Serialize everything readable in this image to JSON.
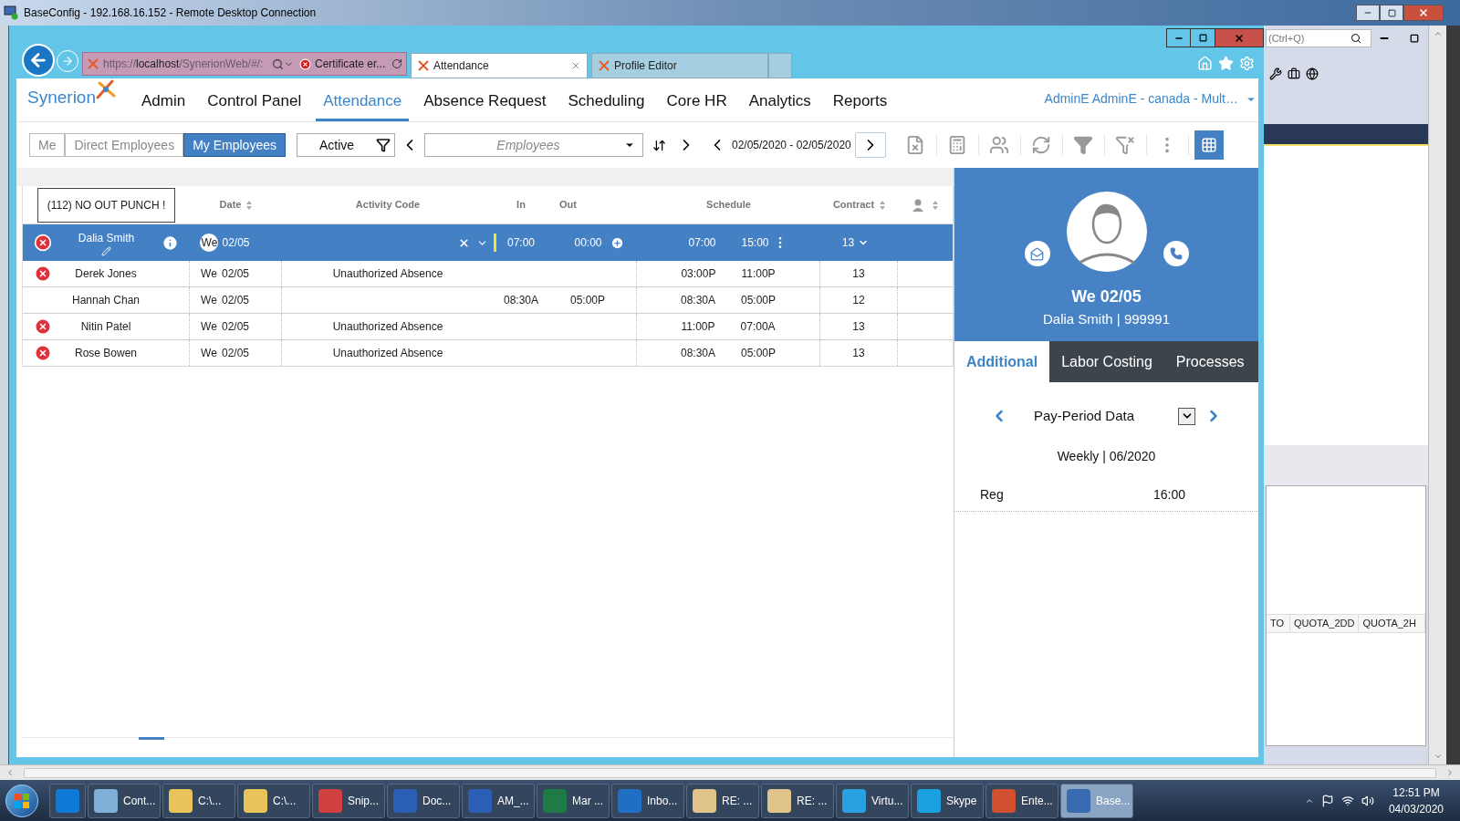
{
  "remote_window": {
    "title": "BaseConfig - 192.168.16.152 - Remote Desktop Connection"
  },
  "browser": {
    "address": {
      "scheme": "https://",
      "host": "localhost",
      "path": "/SynerionWeb/#/:"
    },
    "certificate": "Certificate er...",
    "tabs": [
      {
        "label": "Attendance",
        "selected": true
      },
      {
        "label": "Profile Editor",
        "selected": false
      }
    ]
  },
  "app": {
    "logo": "Synerion",
    "nav": [
      {
        "label": "Admin",
        "selected": false
      },
      {
        "label": "Control Panel",
        "selected": false
      },
      {
        "label": "Attendance",
        "selected": true
      },
      {
        "label": "Absence Request",
        "selected": false
      },
      {
        "label": "Scheduling",
        "selected": false
      },
      {
        "label": "Core HR",
        "selected": false
      },
      {
        "label": "Analytics",
        "selected": false
      },
      {
        "label": "Reports",
        "selected": false
      }
    ],
    "user": "AdminE AdminE - canada - Mult…",
    "scope": [
      {
        "label": "Me",
        "selected": false
      },
      {
        "label": "Direct Employees",
        "selected": false
      },
      {
        "label": "My Employees",
        "selected": true
      }
    ],
    "status_filter": "Active",
    "employee_select": {
      "placeholder": "Employees"
    },
    "date_range": "02/05/2020 - 02/05/2020"
  },
  "table": {
    "tooltip": "(112) NO OUT PUNCH !",
    "columns": [
      "Date",
      "Activity Code",
      "In",
      "Out",
      "Schedule",
      "Contract"
    ],
    "rows": [
      {
        "error": true,
        "selected": true,
        "name": "Dalia Smith",
        "day": "We",
        "date": "02/05",
        "in": "07:00",
        "out": "00:00",
        "sched_start": "07:00",
        "sched_end": "15:00",
        "contract": "13"
      },
      {
        "error": true,
        "selected": false,
        "name": "Derek Jones",
        "day": "We",
        "date": "02/05",
        "activity": "Unauthorized Absence",
        "sched_start": "03:00P",
        "sched_end": "11:00P",
        "contract": "13"
      },
      {
        "error": false,
        "selected": false,
        "name": "Hannah Chan",
        "day": "We",
        "date": "02/05",
        "in": "08:30A",
        "out": "05:00P",
        "sched_start": "08:30A",
        "sched_end": "05:00P",
        "contract": "12"
      },
      {
        "error": true,
        "selected": false,
        "name": "Nitin Patel",
        "day": "We",
        "date": "02/05",
        "activity": "Unauthorized Absence",
        "sched_start": "11:00P",
        "sched_end": "07:00A",
        "contract": "13"
      },
      {
        "error": true,
        "selected": false,
        "name": "Rose Bowen",
        "day": "We",
        "date": "02/05",
        "activity": "Unauthorized Absence",
        "sched_start": "08:30A",
        "sched_end": "05:00P",
        "contract": "13"
      }
    ]
  },
  "detail": {
    "date": "We 02/05",
    "employee": "Dalia Smith | 999991",
    "tabs": [
      {
        "label": "Additional",
        "selected": true
      },
      {
        "label": "Labor Costing",
        "selected": false
      },
      {
        "label": "Processes",
        "selected": false
      }
    ],
    "period_label": "Pay-Period Data",
    "period": "Weekly | 06/2020",
    "rows": [
      {
        "label": "Reg",
        "value": "16:00"
      }
    ]
  },
  "background_app": {
    "search": {
      "placeholder": "(Ctrl+Q)"
    },
    "columns": [
      "TO",
      "QUOTA_2DD",
      "QUOTA_2H"
    ]
  },
  "taskbar": {
    "items": [
      {
        "color": "#0e7ad6",
        "selected": false
      },
      {
        "label": "Cont...",
        "color": "#7fb0d8",
        "selected": false
      },
      {
        "label": "C:\\...",
        "color": "#e8c35a",
        "selected": false
      },
      {
        "label": "C:\\...",
        "color": "#e8c35a",
        "selected": false
      },
      {
        "label": "Snip...",
        "color": "#d04040",
        "selected": false
      },
      {
        "label": "Doc...",
        "color": "#2b5fb4",
        "selected": false
      },
      {
        "label": "AM_...",
        "color": "#2b5fb4",
        "selected": false
      },
      {
        "label": "Mar ...",
        "color": "#1f7a45",
        "selected": false
      },
      {
        "label": "Inbo...",
        "color": "#1f6fc4",
        "selected": false
      },
      {
        "label": "RE: ...",
        "color": "#e0c48a",
        "selected": false
      },
      {
        "label": "RE: ...",
        "color": "#e0c48a",
        "selected": false
      },
      {
        "label": "Virtu...",
        "color": "#2aa0e0",
        "selected": false
      },
      {
        "label": "Skype",
        "color": "#1ba0e0",
        "selected": false
      },
      {
        "label": "Ente...",
        "color": "#d05030",
        "selected": false
      },
      {
        "label": "Base...",
        "color": "#3a6ab0",
        "selected": true
      }
    ],
    "time": "12:51 PM",
    "date": "04/03/2020"
  }
}
